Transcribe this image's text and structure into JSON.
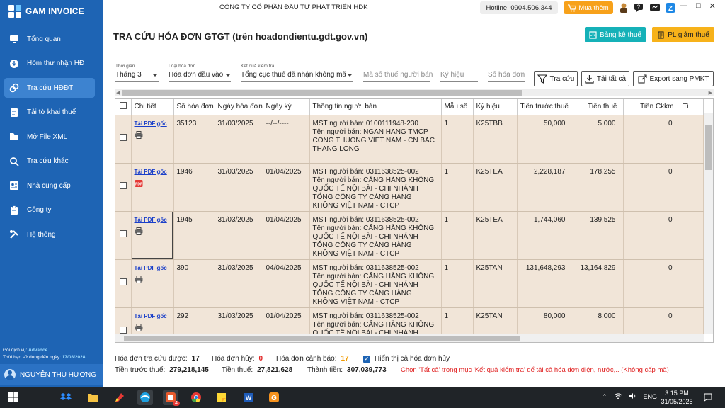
{
  "app": {
    "name": "GAM INVOICE"
  },
  "sidebar": {
    "items": [
      {
        "label": "Tổng quan",
        "icon": "monitor-icon"
      },
      {
        "label": "Hòm thư nhận HĐ",
        "icon": "download-icon"
      },
      {
        "label": "Tra cứu HĐĐT",
        "icon": "link-icon"
      },
      {
        "label": "Tải tờ khai thuế",
        "icon": "document-icon"
      },
      {
        "label": "Mở File XML",
        "icon": "folder-icon"
      },
      {
        "label": "Tra cứu khác",
        "icon": "search-icon"
      },
      {
        "label": "Nhà cung cấp",
        "icon": "contact-card-icon"
      },
      {
        "label": "Công ty",
        "icon": "clipboard-icon"
      },
      {
        "label": "Hệ thống",
        "icon": "tools-icon"
      }
    ],
    "active_index": 2,
    "plan": {
      "package_label": "Gói dịch vụ:",
      "package_value": "Advance",
      "expiry_label": "Thời hạn sử dụng đến ngày:",
      "expiry_value": "17/03/2028"
    },
    "user": "NGUYỄN THU HƯƠNG"
  },
  "header": {
    "company": "CÔNG TY CỔ PHẦN ĐẦU TƯ PHÁT TRIỂN HDK",
    "hotline": "Hotline: 0904.506.344",
    "buy_label": "Mua thêm"
  },
  "page": {
    "title": "TRA CỨU HÓA ĐƠN GTGT (trên hoadondientu.gdt.gov.vn)",
    "btn_bangke": "Bảng kê thuế",
    "btn_plgiam": "PL giảm thuế"
  },
  "filters": {
    "period": {
      "label": "Thời gian",
      "value": "Tháng 3"
    },
    "type": {
      "label": "Loại hóa đơn",
      "value": "Hóa đơn đầu vào"
    },
    "result": {
      "label": "Kết quả kiểm tra",
      "value": "Tổng cục thuế đã nhận không mã"
    },
    "tax_code_ph": "Mã số thuế người bán",
    "symbol_ph": "Ký hiệu",
    "number_ph": "Số hóa đơn",
    "btn_search": "Tra cứu",
    "btn_download_all": "Tải tất cả",
    "btn_export": "Export sang PMKT"
  },
  "table": {
    "columns": [
      "",
      "Chi tiết",
      "Số hóa đơn",
      "Ngày hóa đơn",
      "Ngày ký",
      "Thông tin người bán",
      "Mẫu số",
      "Ký hiệu",
      "Tiền trước thuế",
      "Tiền thuế",
      "Tiền Ckkm",
      "Ti"
    ],
    "pdf_label": "Tải PDF gốc",
    "rows": [
      {
        "so": "35123",
        "ngay_hd": "31/03/2025",
        "ngay_ky": "--/--/----",
        "seller": "MST người bán: 0100111948-230\nTên người bán: NGAN HANG TMCP CONG THUONG VIET NAM - CN BAC THANG LONG",
        "mau": "1",
        "ky_hieu": "K25TBB",
        "truoc_thue": "50,000",
        "thue": "5,000",
        "ckkm": "0",
        "icon": "printer-icon"
      },
      {
        "so": "1946",
        "ngay_hd": "31/03/2025",
        "ngay_ky": "01/04/2025",
        "seller": "MST người bán: 0311638525-002\nTên người bán: CẢNG HÀNG KHÔNG QUỐC TẾ NỘI BÀI - CHI NHÁNH TỔNG CÔNG TY CẢNG HÀNG KHÔNG VIỆT NAM - CTCP",
        "mau": "1",
        "ky_hieu": "K25TEA",
        "truoc_thue": "2,228,187",
        "thue": "178,255",
        "ckkm": "0",
        "icon": "pdf-file-icon"
      },
      {
        "so": "1945",
        "ngay_hd": "31/03/2025",
        "ngay_ky": "01/04/2025",
        "seller": "MST người bán: 0311638525-002\nTên người bán: CẢNG HÀNG KHÔNG QUỐC TẾ NỘI BÀI - CHI NHÁNH TỔNG CÔNG TY CẢNG HÀNG KHÔNG VIỆT NAM - CTCP",
        "mau": "1",
        "ky_hieu": "K25TEA",
        "truoc_thue": "1,744,060",
        "thue": "139,525",
        "ckkm": "0",
        "icon": "printer-icon"
      },
      {
        "so": "390",
        "ngay_hd": "31/03/2025",
        "ngay_ky": "04/04/2025",
        "seller": "MST người bán: 0311638525-002\nTên người bán: CẢNG HÀNG KHÔNG QUỐC TẾ NỘI BÀI - CHI NHÁNH TỔNG CÔNG TY CẢNG HÀNG KHÔNG VIỆT NAM - CTCP",
        "mau": "1",
        "ky_hieu": "K25TAN",
        "truoc_thue": "131,648,293",
        "thue": "13,164,829",
        "ckkm": "0",
        "icon": "printer-icon"
      },
      {
        "so": "292",
        "ngay_hd": "31/03/2025",
        "ngay_ky": "01/04/2025",
        "seller": "MST người bán: 0311638525-002\nTên người bán: CẢNG HÀNG KHÔNG QUỐC TẾ NỘI BÀI - CHI NHÁNH TỔNG CÔNG TY CẢNG HÀNG KHÔNG VIỆT NAM - CTCP",
        "mau": "1",
        "ky_hieu": "K25TAN",
        "truoc_thue": "80,000",
        "thue": "8,000",
        "ckkm": "0",
        "icon": "printer-icon"
      }
    ]
  },
  "summary": {
    "found_label": "Hóa đơn tra cứu được:",
    "found": "17",
    "cancel_label": "Hóa đơn hủy:",
    "cancel": "0",
    "warn_label": "Hóa đơn cảnh báo:",
    "warn": "17",
    "show_cancel": "Hiển thị cả hóa đơn hủy",
    "pre_tax_label": "Tiền trước thuế:",
    "pre_tax": "279,218,145",
    "tax_label": "Tiền thuế:",
    "tax": "27,821,628",
    "total_label": "Thành tiền:",
    "total": "307,039,773",
    "hint": "Chọn 'Tất cả' trong mục 'Kết quả kiểm tra' để tải cả hóa đơn điện, nước,.. (Không cấp mã)"
  },
  "taskbar": {
    "lang": "ENG",
    "time": "3:15 PM",
    "date": "31/05/2025",
    "badge": "4"
  },
  "colors": {
    "sidebar": "#1e64b4",
    "teal": "#15b1b8",
    "amber": "#f7b21a",
    "row_bg": "#f1e5d8"
  }
}
